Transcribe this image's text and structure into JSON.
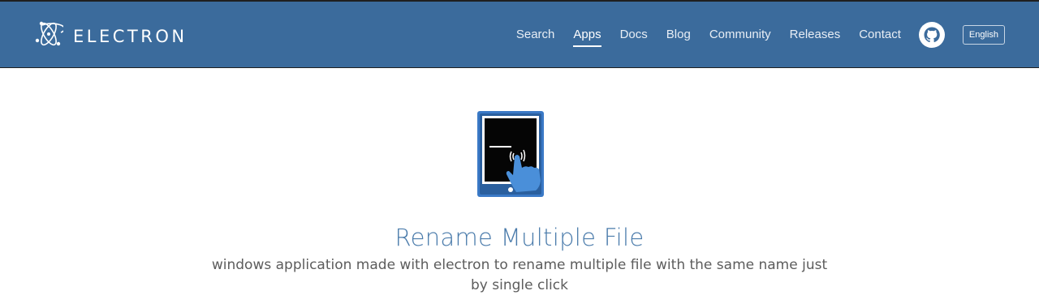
{
  "header": {
    "brand": "ELECTRON",
    "nav": [
      {
        "label": "Search",
        "active": false
      },
      {
        "label": "Apps",
        "active": true
      },
      {
        "label": "Docs",
        "active": false
      },
      {
        "label": "Blog",
        "active": false
      },
      {
        "label": "Community",
        "active": false
      },
      {
        "label": "Releases",
        "active": false
      },
      {
        "label": "Contact",
        "active": false
      }
    ],
    "language": "English",
    "github_icon": "github-icon"
  },
  "app": {
    "icon": "tablet-tap-icon",
    "title": "Rename Multiple File",
    "description": "windows application made with electron to rename multiple file with the same name just by single click"
  },
  "colors": {
    "header_bg": "#3b6b9c",
    "title": "#4a7bab",
    "description": "#5c5c5c"
  }
}
